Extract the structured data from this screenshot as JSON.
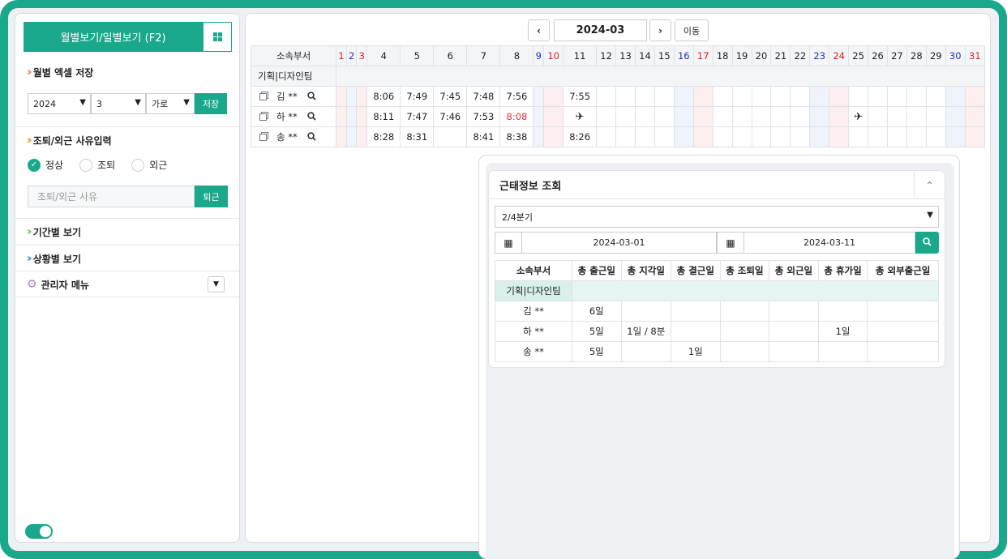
{
  "sidebar": {
    "view_toggle_label": "월별보기/일별보기 (F2)",
    "excel": {
      "title": "월별 엑셀 저장",
      "year": "2024",
      "month": "3",
      "orientation": "가로",
      "save_label": "저장"
    },
    "leave": {
      "title": "조퇴/외근 사유입력",
      "options": [
        "정상",
        "조퇴",
        "외근"
      ],
      "selected": "정상",
      "reason_placeholder": "조퇴/외근 사유",
      "submit_label": "퇴근"
    },
    "period_title": "기간별 보기",
    "status_title": "상황별 보기",
    "admin_title": "관리자 메뉴"
  },
  "calendar": {
    "month": "2024-03",
    "move_label": "이동",
    "dept_header": "소속부서",
    "days": [
      "1",
      "2",
      "3",
      "4",
      "5",
      "6",
      "7",
      "8",
      "9",
      "10",
      "11",
      "12",
      "13",
      "14",
      "15",
      "16",
      "17",
      "18",
      "19",
      "20",
      "21",
      "22",
      "23",
      "24",
      "25",
      "26",
      "27",
      "28",
      "29",
      "30",
      "31"
    ],
    "department": "기획|디자인팀",
    "rows": [
      {
        "name": "김 **",
        "cells": {
          "4": "8:06",
          "5": "7:49",
          "6": "7:45",
          "7": "7:48",
          "8": "7:56",
          "11": "7:55"
        }
      },
      {
        "name": "하 **",
        "cells": {
          "4": "8:11",
          "5": "7:47",
          "6": "7:46",
          "7": "7:53",
          "8": "8:08",
          "11": "✈",
          "25": "✈"
        },
        "late": [
          "8"
        ]
      },
      {
        "name": "송 **",
        "cells": {
          "4": "8:28",
          "5": "8:31",
          "7": "8:41",
          "8": "8:38",
          "11": "8:26"
        }
      }
    ]
  },
  "summary": {
    "title": "근태정보 조회",
    "quarter": "2/4분기",
    "start_date": "2024-03-01",
    "end_date": "2024-03-11",
    "headers": [
      "소속부서",
      "총 출근일",
      "총 지각일",
      "총 결근일",
      "총 조퇴일",
      "총 외근일",
      "총 휴가일",
      "총 외부출근일"
    ],
    "department": "기획|디자인팀",
    "rows": [
      [
        "김 **",
        "6일",
        "",
        "",
        "",
        "",
        "",
        ""
      ],
      [
        "하 **",
        "5일",
        "1일 / 8분",
        "",
        "",
        "",
        "1일",
        ""
      ],
      [
        "송 **",
        "5일",
        "",
        "1일",
        "",
        "",
        "",
        ""
      ]
    ]
  },
  "colors": {
    "accent": "#1aa88c",
    "saturday": "#2030c8",
    "sunday": "#e21c2c"
  }
}
